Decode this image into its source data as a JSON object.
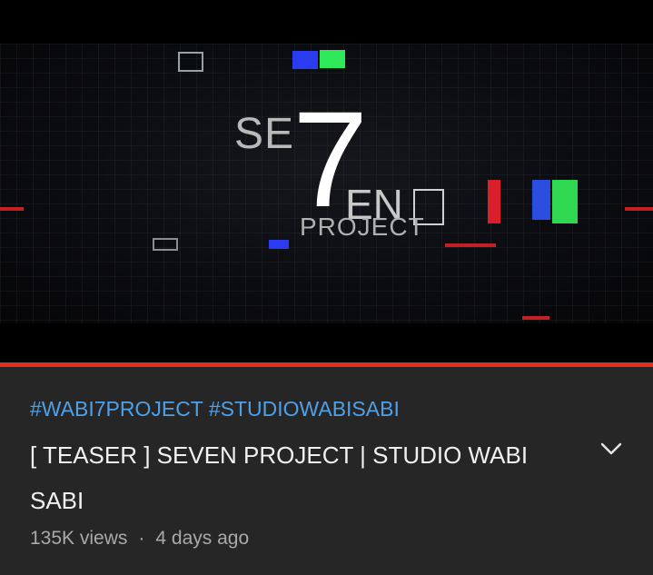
{
  "video": {
    "thumbnail_title_parts": {
      "se": "SE",
      "seven": "7",
      "en": "EN",
      "project": "PROJECT"
    },
    "progress_color": "#e52a1f"
  },
  "info": {
    "hashtags": "#WABI7PROJECT #STUDIOWABISABI",
    "title": "[ TEASER ] SEVEN PROJECT | STUDIO WABI SABI",
    "views": "135K views",
    "separator": "·",
    "age": "4 days ago",
    "expand_icon": "chevron-down-icon"
  },
  "colors": {
    "background": "#262626",
    "hashtag": "#4ea0e8",
    "title": "#f1f1f1",
    "meta": "#a9a9a9"
  }
}
